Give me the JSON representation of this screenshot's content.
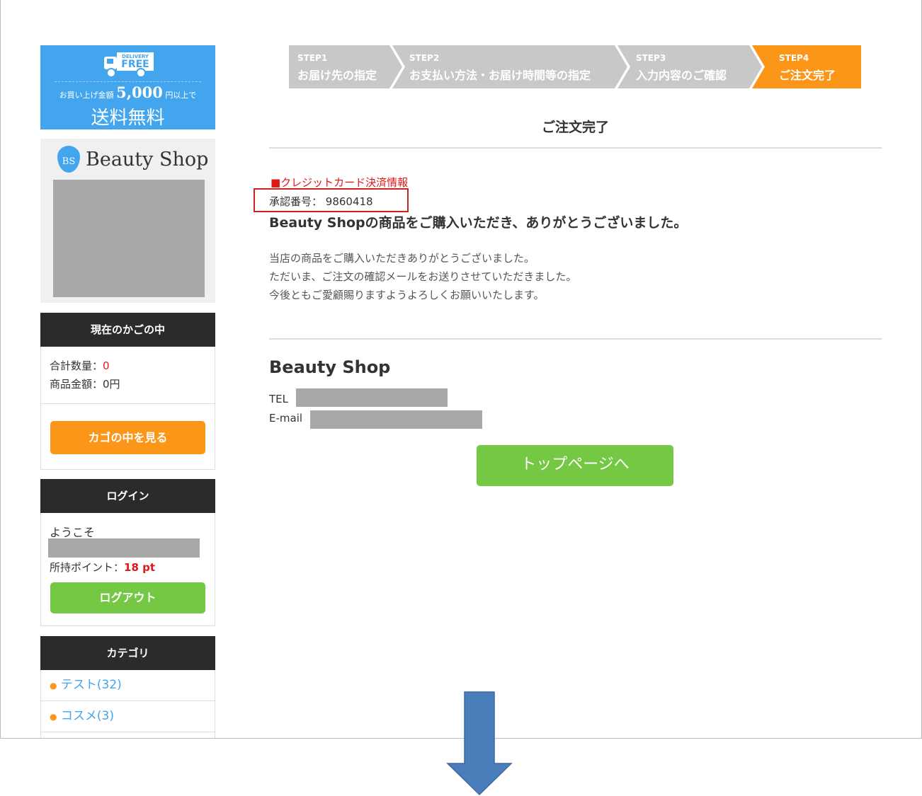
{
  "banner": {
    "badge_top": "DELIVERY",
    "badge": "FREE",
    "cond_pre": "お買い上げ金額",
    "amount": "5,000",
    "cond_post": "円以上で",
    "free": "送料無料"
  },
  "logo": {
    "initials": "BS",
    "name": "Beauty Shop"
  },
  "cart": {
    "title": "現在のかごの中",
    "qty_label": "合計数量：",
    "qty": "0",
    "amount_label": "商品金額：",
    "amount": "0円",
    "button": "カゴの中を見る"
  },
  "login": {
    "title": "ログイン",
    "welcome": "ようこそ",
    "points_label": "所持ポイント：",
    "points": "18 pt",
    "button": "ログアウト"
  },
  "category": {
    "title": "カテゴリ",
    "items": [
      {
        "label": "テスト(32)"
      },
      {
        "label": "コスメ(3)"
      }
    ]
  },
  "steps": [
    {
      "num": "STEP1",
      "label": "お届け先の指定"
    },
    {
      "num": "STEP2",
      "label": "お支払い方法・お届け時間等の指定"
    },
    {
      "num": "STEP3",
      "label": "入力内容のご確認"
    },
    {
      "num": "STEP4",
      "label": "ご注文完了"
    }
  ],
  "main": {
    "title": "ご注文完了",
    "payment_heading": "■クレジットカード決済情報",
    "approval_label": "承認番号：",
    "approval": "9860418",
    "thanks": "Beauty Shopの商品をご購入いただき、ありがとうございました。",
    "body": [
      "当店の商品をご購入いただきありがとうございました。",
      "ただいま、ご注文の確認メールをお送りさせていただきました。",
      "今後ともご愛顧賜りますようよろしくお願いいたします。"
    ],
    "shop_name": "Beauty Shop",
    "tel_label": "TEL",
    "email_label": "E-mail",
    "top_button": "トップページへ"
  },
  "colors": {
    "orange": "#fb9619",
    "green": "#74c843",
    "blue": "#42a5ee",
    "arrow": "#4a7ebb"
  }
}
